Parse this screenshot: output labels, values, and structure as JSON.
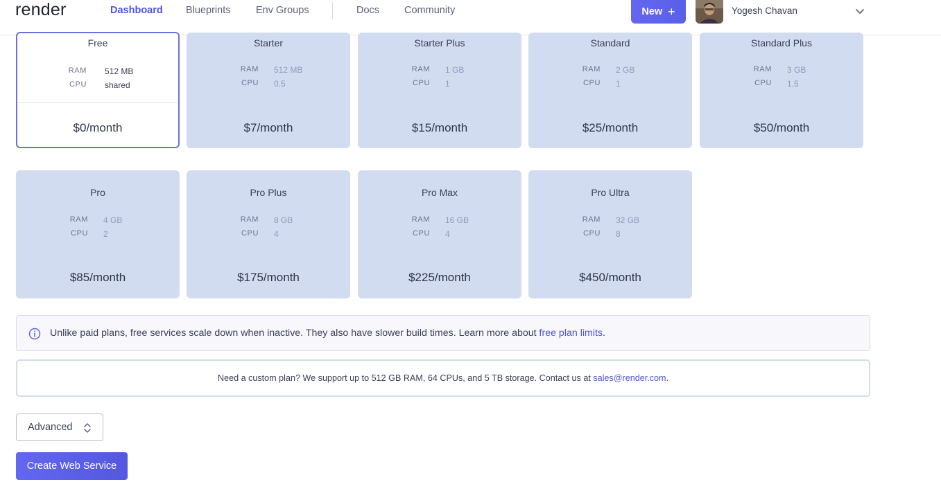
{
  "header": {
    "logo": "render",
    "nav": [
      {
        "label": "Dashboard",
        "active": true
      },
      {
        "label": "Blueprints"
      },
      {
        "label": "Env Groups"
      },
      {
        "label": "Docs"
      },
      {
        "label": "Community"
      }
    ],
    "new_button": "New",
    "user_name": "Yogesh Chavan"
  },
  "spec_labels": {
    "ram": "RAM",
    "cpu": "CPU"
  },
  "plans": [
    {
      "name": "Free",
      "ram": "512 MB",
      "cpu": "shared",
      "price": "$0/month",
      "selected": true
    },
    {
      "name": "Starter",
      "ram": "512 MB",
      "cpu": "0.5",
      "price": "$7/month"
    },
    {
      "name": "Starter Plus",
      "ram": "1 GB",
      "cpu": "1",
      "price": "$15/month"
    },
    {
      "name": "Standard",
      "ram": "2 GB",
      "cpu": "1",
      "price": "$25/month"
    },
    {
      "name": "Standard Plus",
      "ram": "3 GB",
      "cpu": "1.5",
      "price": "$50/month"
    },
    {
      "name": "Pro",
      "ram": "4 GB",
      "cpu": "2",
      "price": "$85/month"
    },
    {
      "name": "Pro Plus",
      "ram": "8 GB",
      "cpu": "4",
      "price": "$175/month"
    },
    {
      "name": "Pro Max",
      "ram": "16 GB",
      "cpu": "4",
      "price": "$225/month"
    },
    {
      "name": "Pro Ultra",
      "ram": "32 GB",
      "cpu": "8",
      "price": "$450/month"
    }
  ],
  "notice": {
    "text": "Unlike paid plans, free services scale down when inactive. They also have slower build times. Learn more about ",
    "link": "free plan limits",
    "suffix": "."
  },
  "custom_plan": {
    "text": "Need a custom plan? We support up to 512 GB RAM, 64 CPUs, and 5 TB storage. Contact us at ",
    "email": "sales@render.com",
    "suffix": "."
  },
  "advanced_label": "Advanced",
  "create_button": "Create Web Service",
  "colors": {
    "accent": "#5b61e0",
    "card_bg": "#d2dcf0",
    "link": "#4f55d8"
  }
}
